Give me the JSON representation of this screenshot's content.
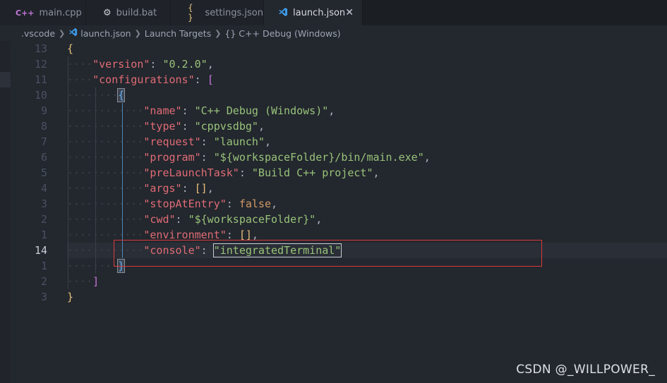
{
  "tabs": [
    {
      "label": "main.cpp",
      "icon": "C++"
    },
    {
      "label": "build.bat",
      "icon": "⚙"
    },
    {
      "label": "settings.json",
      "icon": "{ }"
    },
    {
      "label": "launch.json",
      "icon": "vscode-icon",
      "close": "✕"
    }
  ],
  "breadcrumb": {
    "folder": ".vscode",
    "file": "launch.json",
    "section": "Launch Targets",
    "item": "{} C++ Debug (Windows)"
  },
  "editor": {
    "lines": [
      {
        "num": "13",
        "indent": 0,
        "tokens": [
          [
            "b1",
            "{"
          ]
        ]
      },
      {
        "num": "12",
        "indent": 1,
        "tokens": [
          [
            "k",
            "\"version\""
          ],
          [
            "p",
            ": "
          ],
          [
            "s",
            "\"0.2.0\""
          ],
          [
            "p",
            ","
          ]
        ]
      },
      {
        "num": "11",
        "indent": 1,
        "tokens": [
          [
            "k",
            "\"configurations\""
          ],
          [
            "p",
            ": "
          ],
          [
            "b2",
            "["
          ]
        ]
      },
      {
        "num": "10",
        "indent": 2,
        "tokens": [
          [
            "b3 sel-open",
            "{"
          ]
        ]
      },
      {
        "num": "9",
        "indent": 3,
        "tokens": [
          [
            "k",
            "\"name\""
          ],
          [
            "p",
            ": "
          ],
          [
            "s",
            "\"C++ Debug (Windows)\""
          ],
          [
            "p",
            ","
          ]
        ]
      },
      {
        "num": "8",
        "indent": 3,
        "tokens": [
          [
            "k",
            "\"type\""
          ],
          [
            "p",
            ": "
          ],
          [
            "s",
            "\"cppvsdbg\""
          ],
          [
            "p",
            ","
          ]
        ]
      },
      {
        "num": "7",
        "indent": 3,
        "tokens": [
          [
            "k",
            "\"request\""
          ],
          [
            "p",
            ": "
          ],
          [
            "s",
            "\"launch\""
          ],
          [
            "p",
            ","
          ]
        ]
      },
      {
        "num": "6",
        "indent": 3,
        "tokens": [
          [
            "k",
            "\"program\""
          ],
          [
            "p",
            ": "
          ],
          [
            "s",
            "\"${workspaceFolder}/bin/main.exe\""
          ],
          [
            "p",
            ","
          ]
        ]
      },
      {
        "num": "5",
        "indent": 3,
        "tokens": [
          [
            "k",
            "\"preLaunchTask\""
          ],
          [
            "p",
            ": "
          ],
          [
            "s",
            "\"Build C++ project\""
          ],
          [
            "p",
            ","
          ]
        ]
      },
      {
        "num": "4",
        "indent": 3,
        "tokens": [
          [
            "k",
            "\"args\""
          ],
          [
            "p",
            ": "
          ],
          [
            "b1",
            "[]"
          ],
          [
            "p",
            ","
          ]
        ]
      },
      {
        "num": "3",
        "indent": 3,
        "tokens": [
          [
            "k",
            "\"stopAtEntry\""
          ],
          [
            "p",
            ": "
          ],
          [
            "kw",
            "false"
          ],
          [
            "p",
            ","
          ]
        ]
      },
      {
        "num": "2",
        "indent": 3,
        "tokens": [
          [
            "k",
            "\"cwd\""
          ],
          [
            "p",
            ": "
          ],
          [
            "s",
            "\"${workspaceFolder}\""
          ],
          [
            "p",
            ","
          ]
        ]
      },
      {
        "num": "1",
        "indent": 3,
        "tokens": [
          [
            "k",
            "\"environment\""
          ],
          [
            "p",
            ": "
          ],
          [
            "b1",
            "[]"
          ],
          [
            "p",
            ","
          ]
        ]
      },
      {
        "num": "14",
        "indent": 3,
        "current": true,
        "tokens": [
          [
            "k",
            "\"console\""
          ],
          [
            "p",
            ": "
          ],
          [
            "s match-str",
            "\"integratedTerminal\""
          ]
        ]
      },
      {
        "num": "1",
        "indent": 2,
        "tokens": [
          [
            "b3 sel-close",
            "}"
          ]
        ]
      },
      {
        "num": "2",
        "indent": 1,
        "tokens": [
          [
            "b2",
            "]"
          ]
        ]
      },
      {
        "num": "3",
        "indent": 0,
        "tokens": [
          [
            "b1",
            "}"
          ]
        ]
      }
    ]
  },
  "watermark": "CSDN @_WILLPOWER_"
}
